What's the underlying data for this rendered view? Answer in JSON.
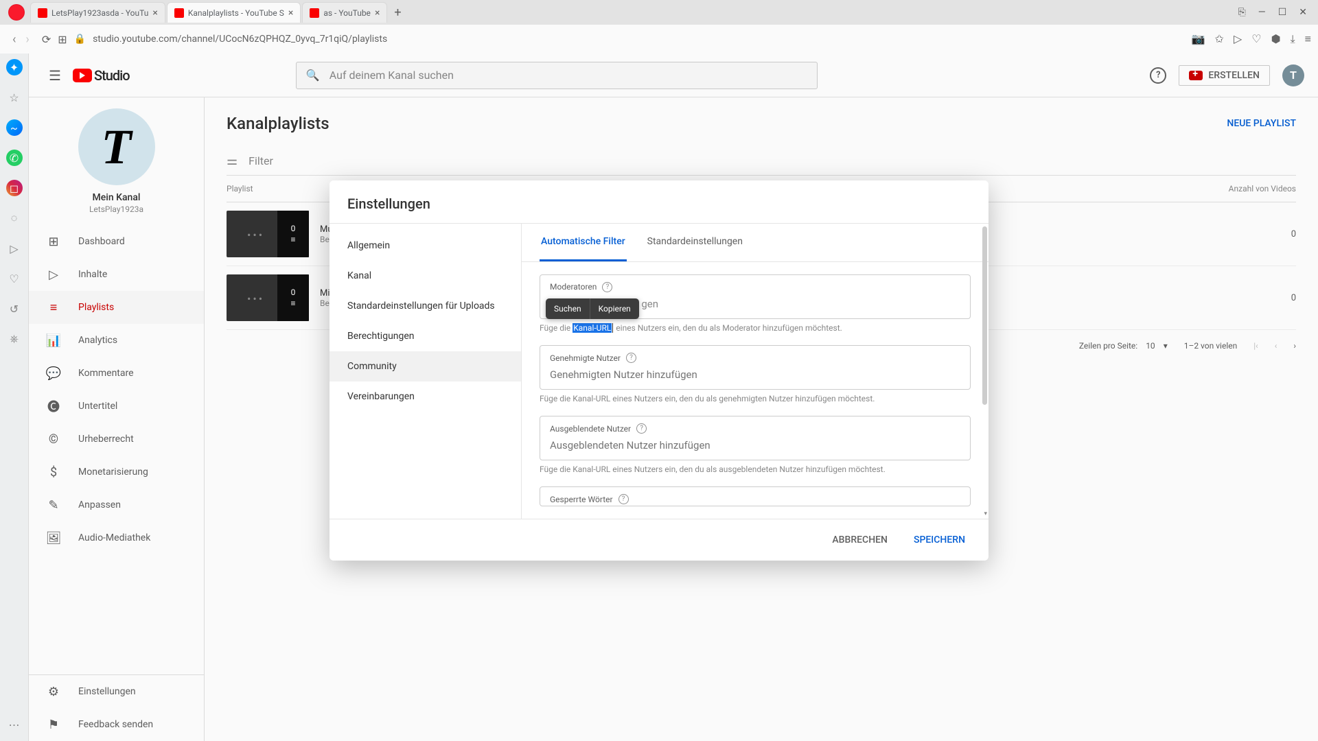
{
  "browser": {
    "tabs": [
      {
        "title": "LetsPlay1923asda - YouTu",
        "active": false
      },
      {
        "title": "Kanalplaylists - YouTube S",
        "active": true
      },
      {
        "title": "as - YouTube",
        "active": false
      }
    ],
    "url": "studio.youtube.com/channel/UCocN6zQPHQZ_0yvq_7r1qiQ/playlists"
  },
  "header": {
    "logo_text": "Studio",
    "search_placeholder": "Auf deinem Kanal suchen",
    "create_label": "ERSTELLEN",
    "avatar_letter": "T"
  },
  "channel": {
    "avatar_letter": "T",
    "name": "Mein Kanal",
    "handle": "LetsPlay1923a"
  },
  "sidebar": {
    "items": [
      {
        "icon": "⊞",
        "label": "Dashboard"
      },
      {
        "icon": "▷",
        "label": "Inhalte"
      },
      {
        "icon": "≡",
        "label": "Playlists"
      },
      {
        "icon": "📊",
        "label": "Analytics"
      },
      {
        "icon": "💬",
        "label": "Kommentare"
      },
      {
        "icon": "🅒",
        "label": "Untertitel"
      },
      {
        "icon": "©",
        "label": "Urheberrecht"
      },
      {
        "icon": "$",
        "label": "Monetarisierung"
      },
      {
        "icon": "✎",
        "label": "Anpassen"
      },
      {
        "icon": "🖼",
        "label": "Audio-Mediathek"
      }
    ],
    "bottom": [
      {
        "icon": "⚙",
        "label": "Einstellungen"
      },
      {
        "icon": "⚑",
        "label": "Feedback senden"
      }
    ]
  },
  "page": {
    "title": "Kanalplaylists",
    "new_playlist": "NEUE PLAYLIST",
    "filter_label": "Filter",
    "columns": {
      "playlist": "Playlist",
      "count": "Anzahl von Videos"
    },
    "rows": [
      {
        "title": "Musik",
        "desc": "Besch",
        "thumb_count": "0",
        "count": "0"
      },
      {
        "title": "Minec",
        "desc": "Besch",
        "thumb_count": "0",
        "count": "0"
      }
    ],
    "pagination": {
      "rows_label": "Zeilen pro Seite:",
      "rows_value": "10",
      "range": "1–2 von vielen"
    }
  },
  "modal": {
    "title": "Einstellungen",
    "nav": [
      "Allgemein",
      "Kanal",
      "Standardeinstellungen für Uploads",
      "Berechtigungen",
      "Community",
      "Vereinbarungen"
    ],
    "nav_active": 4,
    "tabs": [
      "Automatische Filter",
      "Standardeinstellungen"
    ],
    "tab_active": 0,
    "fields": {
      "moderators": {
        "label": "Moderatoren",
        "placeholder": "gen",
        "help_pre": "Füge die ",
        "help_highlight": "Kanal-URL",
        "help_post": " eines Nutzers ein, den du als Moderator hinzufügen möchtest."
      },
      "approved": {
        "label": "Genehmigte Nutzer",
        "placeholder": "Genehmigten Nutzer hinzufügen",
        "help": "Füge die Kanal-URL eines Nutzers ein, den du als genehmigten Nutzer hinzufügen möchtest."
      },
      "hidden": {
        "label": "Ausgeblendete Nutzer",
        "placeholder": "Ausgeblendeten Nutzer hinzufügen",
        "help": "Füge die Kanal-URL eines Nutzers ein, den du als ausgeblendeten Nutzer hinzufügen möchtest."
      },
      "blocked": {
        "label": "Gesperrte Wörter"
      }
    },
    "cancel": "ABBRECHEN",
    "save": "SPEICHERN",
    "context": {
      "search": "Suchen",
      "copy": "Kopieren"
    }
  }
}
